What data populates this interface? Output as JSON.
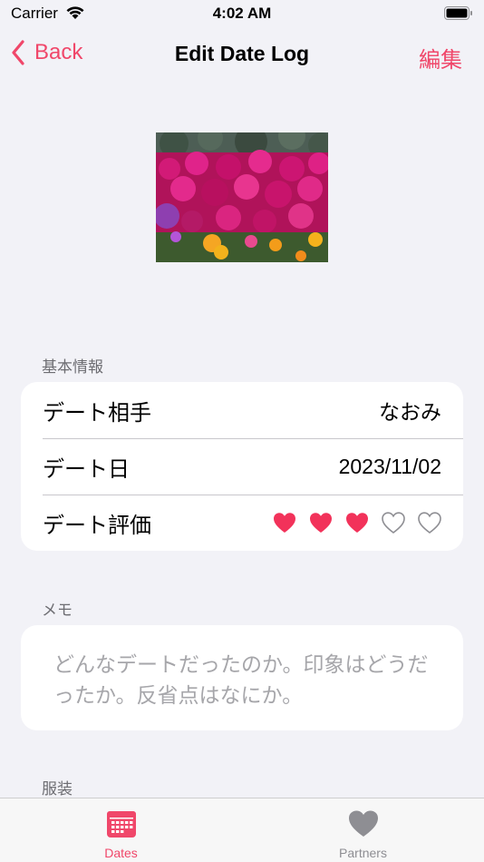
{
  "status_bar": {
    "carrier": "Carrier",
    "time": "4:02 AM"
  },
  "nav": {
    "back_label": "Back",
    "title": "Edit Date Log",
    "edit_label": "編集"
  },
  "basic_info": {
    "section_title": "基本情報",
    "partner_label": "デート相手",
    "partner_value": "なおみ",
    "date_label": "デート日",
    "date_value": "2023/11/02",
    "rating_label": "デート評価",
    "rating": 3,
    "rating_max": 5
  },
  "memo": {
    "section_title": "メモ",
    "placeholder": "どんなデートだったのか。印象はどうだったか。反省点はなにか。"
  },
  "outfit": {
    "section_title": "服装"
  },
  "tabbar": {
    "tabs": [
      {
        "label": "Dates",
        "icon": "calendar-icon",
        "selected": true
      },
      {
        "label": "Partners",
        "icon": "heart-icon",
        "selected": false
      }
    ]
  },
  "colors": {
    "accent": "#f0476a",
    "inactive": "#8e8e93"
  }
}
